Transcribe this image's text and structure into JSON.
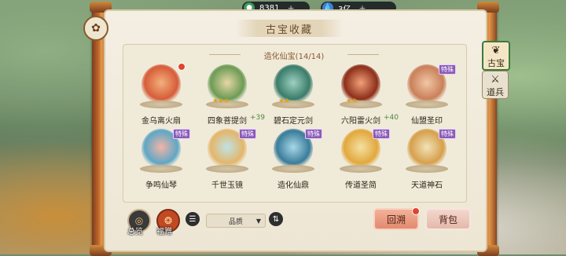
{
  "resources": {
    "jade": "8381",
    "drop": "3亿",
    "plus": "+"
  },
  "title": "古宝收藏",
  "section": "造化仙宝(14/14)",
  "row1": [
    {
      "name": "金乌离火扇",
      "dot": true,
      "colors": [
        "#f3b07c",
        "#d65d3a"
      ]
    },
    {
      "name": "四象菩提剑",
      "stars": "★★★",
      "plus": "+39",
      "colors": [
        "#e7d7a6",
        "#6c9b55"
      ]
    },
    {
      "name": "碧石定元剑",
      "stars": "★★",
      "colors": [
        "#9fd0c0",
        "#3a7c6a"
      ]
    },
    {
      "name": "六阳雷火剑",
      "stars": "★★",
      "plus": "+40",
      "colors": [
        "#f2a07a",
        "#8c2f1a"
      ]
    },
    {
      "name": "仙盟圣印",
      "badge": "特殊",
      "colors": [
        "#f2c6a4",
        "#c9805a"
      ]
    }
  ],
  "row2": [
    {
      "name": "争鸣仙琴",
      "badge": "特殊",
      "colors": [
        "#f3b4a8",
        "#5fa7c4"
      ]
    },
    {
      "name": "千世玉镜",
      "badge": "特殊",
      "colors": [
        "#bfe3e6",
        "#e3b66a"
      ]
    },
    {
      "name": "造化仙鼎",
      "badge": "特殊",
      "colors": [
        "#a9d8e8",
        "#3a7c9a"
      ]
    },
    {
      "name": "传道圣简",
      "badge": "特殊",
      "colors": [
        "#f3e1a4",
        "#e2a83c"
      ]
    },
    {
      "name": "天道神石",
      "badge": "特殊",
      "colors": [
        "#f1e2b8",
        "#d6a04c"
      ]
    }
  ],
  "side_tabs": {
    "active": "古宝",
    "other": "道兵"
  },
  "bottom": {
    "overview": "总览",
    "gift": "福赠",
    "sort_quality": "品质",
    "hecheng": "回溯",
    "beibao": "背包"
  }
}
